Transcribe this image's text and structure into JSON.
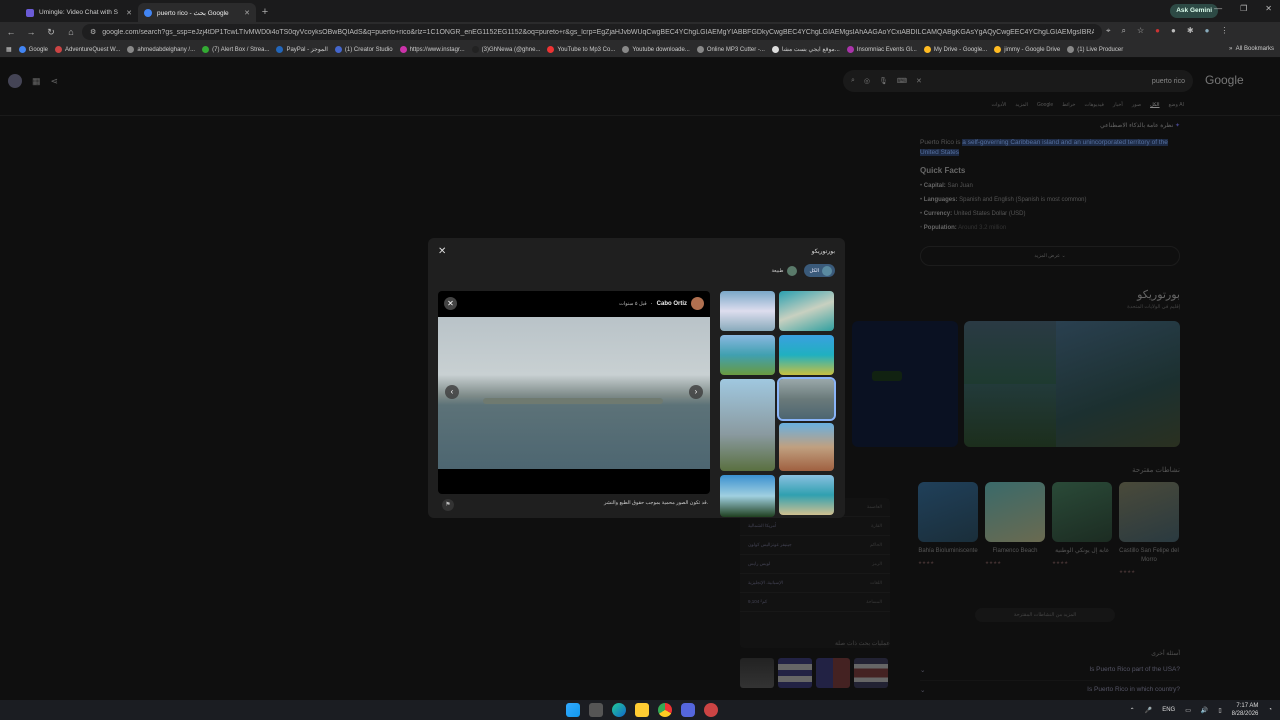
{
  "browser": {
    "tabs": [
      {
        "title": "Umingle: Video Chat with S",
        "active": false,
        "favicon_color": "#6b5bd6"
      },
      {
        "title": "puerto rico - بحث Google",
        "active": true,
        "favicon_color": "#4285f4"
      }
    ],
    "ask_gemini": "Ask Gemini",
    "url": "google.com/search?q=puerto+rico&sca_esv=...&ei=... (truncated)",
    "url_full": "google.com/search?gs_ssp=eJzj4tDP1TcwLTIvMWD0i4oTS0qyVcoyksOBwBQIAdS&q=puerto+rico&rlz=1C1ONGR_enEG1152EG1152&oq=pureto+r&gs_lcrp=EgZjaHJvbWUqCwgBEC4YChgLGIAEMgYIABBFGDkyCwgBEC4YChgLGIAEMgsIAhAAGAoYCxiABDILCAMQABgKGAsYgAQyCwgEEC4YChgLGIAEMgsIBRAAGAoYCxiABDIL...",
    "bookmarks": [
      {
        "label": "Google",
        "color": "#4285f4"
      },
      {
        "label": "AdventureQuest W...",
        "color": "#c44"
      },
      {
        "label": "ahmedabdelghany /...",
        "color": "#888"
      },
      {
        "label": "(7) Alert Box / Strea...",
        "color": "#3a3"
      },
      {
        "label": "PayPal - الموجز",
        "color": "#26b"
      },
      {
        "label": "(1) Creator Studio",
        "color": "#46c"
      },
      {
        "label": "https://www.instagr...",
        "color": "#c3a"
      },
      {
        "label": "(3)GhNewa (@ghne...",
        "color": "#222"
      },
      {
        "label": "YouTube to Mp3 Co...",
        "color": "#e33"
      },
      {
        "label": "Youtube downloade...",
        "color": "#888"
      },
      {
        "label": "Online MP3 Cutter -...",
        "color": "#888"
      },
      {
        "label": "موقع ايجي بست مشا...",
        "color": "#ddd"
      },
      {
        "label": "Insomniac Events Gl...",
        "color": "#a3a"
      },
      {
        "label": "My Drive - Google...",
        "color": "#fb2"
      },
      {
        "label": "jimmy - Google Drive",
        "color": "#fb2"
      },
      {
        "label": "(1) Live Producer",
        "color": "#888"
      }
    ],
    "all_bookmarks": "All Bookmarks"
  },
  "google": {
    "logo": "Google",
    "query": "puerto rico",
    "nav_tabs": [
      "وضع AI",
      "الكل",
      "صور",
      "أخبار",
      "فيديوهات",
      "خرائط",
      "Google",
      "المزيد",
      "الأدوات"
    ],
    "ai_overview_label": "نظرة عامة بالذكاء الاصطناعي",
    "description_plain": "Puerto Rico is",
    "description_highlight": "a self-governing Caribbean island and an unincorporated territory of the United States",
    "quick_facts_title": "Quick Facts",
    "facts": [
      {
        "k": "Capital:",
        "v": "San Juan"
      },
      {
        "k": "Languages:",
        "v": "Spanish and English (Spanish is most common)"
      },
      {
        "k": "Currency:",
        "v": "United States Dollar (USD)"
      },
      {
        "k": "Population:",
        "v": "Around 3.2 million"
      }
    ],
    "show_more": "عرض المزيد",
    "kp_title": "بورتوريكو",
    "kp_subtitle": "إقليم في الولايات المتحدة",
    "things_to_do": "نشاطات مقترحة",
    "cards": [
      {
        "name": "Bahía Bioluminiscente",
        "color1": "#20405a",
        "color2": "#1a2e3a"
      },
      {
        "name": "Flamenco Beach",
        "color1": "#3a6a6a",
        "color2": "#6a6a50"
      },
      {
        "name": "غابة إل يونكي الوطنية",
        "color1": "#2a4a38",
        "color2": "#1c2c22"
      },
      {
        "name": "Castillo San Felipe del Morro",
        "color1": "#4a4a3a",
        "color2": "#2a3a40"
      }
    ],
    "more_things": "المزيد من النشاطات المقترحة",
    "table_rows": [
      {
        "k": "العاصمة",
        "v": ""
      },
      {
        "k": "القارة",
        "v": "أمريكا الشمالية"
      },
      {
        "k": "الحاكم",
        "v": "جينيفر غونزاليس كولون"
      },
      {
        "k": "الرمز",
        "v": "لويس رايس"
      },
      {
        "k": "اللغات",
        "v": "الإسبانية، الإنجليزية"
      },
      {
        "k": "المساحة",
        "v": "9,104 كم²"
      }
    ],
    "people_also_search": "عمليات بحث ذات صلة",
    "other_questions_title": "أسئلة أخرى",
    "questions": [
      "Is Puerto Rico part of the USA?",
      "Is Puerto Rico in which country?"
    ]
  },
  "modal": {
    "title": "بورتوريكو",
    "chips": [
      {
        "label": "الكل",
        "active": true
      },
      {
        "label": "طبيعة",
        "active": false
      }
    ],
    "author": "Cabo Ortiz",
    "time": "قبل ٥ سنوات",
    "caption": "قد تكون الصور محمية بموجب حقوق الطبع والنشر."
  },
  "taskbar": {
    "lang": "ENG",
    "time": "7:17 AM",
    "date": "8/28/2026"
  }
}
